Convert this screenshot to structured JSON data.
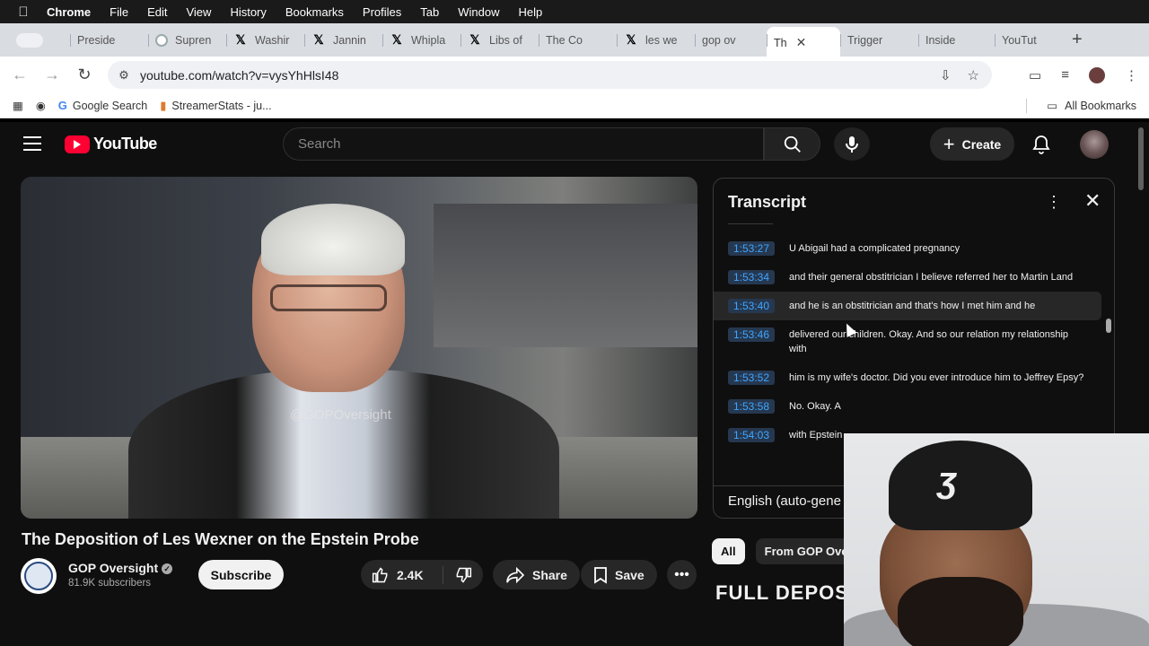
{
  "menubar": {
    "app": "Chrome",
    "items": [
      "File",
      "Edit",
      "View",
      "History",
      "Bookmarks",
      "Profiles",
      "Tab",
      "Window",
      "Help"
    ]
  },
  "tabs": [
    {
      "label": "Preside",
      "icon": "youtube-icon"
    },
    {
      "label": "Supren",
      "icon": "supreme-court-icon"
    },
    {
      "label": "Washir",
      "icon": "x-icon"
    },
    {
      "label": "Jannin",
      "icon": "x-icon"
    },
    {
      "label": "Whipla",
      "icon": "x-icon"
    },
    {
      "label": "Libs of",
      "icon": "x-icon"
    },
    {
      "label": "The Co",
      "icon": "youtube-icon"
    },
    {
      "label": "les we",
      "icon": "x-icon"
    },
    {
      "label": "gop ov",
      "icon": "youtube-icon"
    },
    {
      "label": "Th",
      "icon": "youtube-icon",
      "active": true
    },
    {
      "label": "Trigger",
      "icon": "youtube-icon"
    },
    {
      "label": "Inside",
      "icon": "youtube-icon"
    },
    {
      "label": "YouTut",
      "icon": "youtube-icon"
    }
  ],
  "address": {
    "url": "youtube.com/watch?v=vysYhHlsI48"
  },
  "bookmarks": {
    "items": [
      "Google Search",
      "StreamerStats - ju..."
    ],
    "all": "All Bookmarks"
  },
  "youtube": {
    "logo_text": "YouTube",
    "search_placeholder": "Search",
    "create_label": "Create",
    "video": {
      "watermark": "@GOPOversight",
      "title": "The Deposition of Les Wexner on the Epstein Probe",
      "channel": "GOP Oversight",
      "subscribers": "81.9K subscribers",
      "subscribe_label": "Subscribe",
      "likes": "2.4K",
      "share_label": "Share",
      "save_label": "Save"
    },
    "transcript": {
      "title": "Transcript",
      "segments": [
        {
          "time": "1:53:27",
          "text": "U Abigail had a complicated pregnancy"
        },
        {
          "time": "1:53:34",
          "text": "and their general obstitrician I believe referred her to Martin Land"
        },
        {
          "time": "1:53:40",
          "text": "and he is an obstitrician and that's how I met him and he"
        },
        {
          "time": "1:53:46",
          "text": "delivered our children. Okay. And so our relation my relationship with"
        },
        {
          "time": "1:53:52",
          "text": "him is my wife's doctor. Did you ever introduce him to Jeffrey Epsy?"
        },
        {
          "time": "1:53:58",
          "text": "No. Okay. A"
        },
        {
          "time": "1:54:03",
          "text": "with Epstein"
        }
      ],
      "language": "English (auto-gene"
    },
    "chips": [
      "All",
      "From GOP Ove"
    ],
    "banner": "FULL DEPOS"
  }
}
